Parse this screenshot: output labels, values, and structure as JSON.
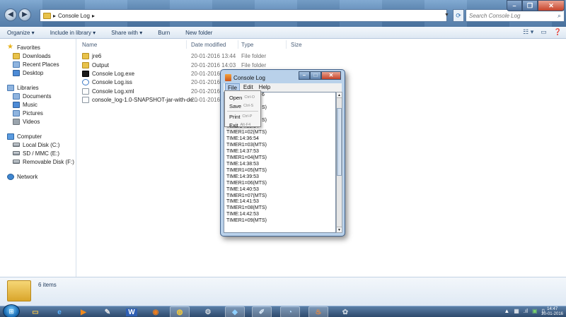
{
  "address": {
    "breadcrumb": [
      "Console Log"
    ]
  },
  "search": {
    "placeholder": "Search Console Log"
  },
  "toolbar": {
    "organize": "Organize ▾",
    "include": "Include in library ▾",
    "share": "Share with ▾",
    "burn": "Burn",
    "new_folder": "New folder"
  },
  "nav": {
    "favorites": "Favorites",
    "favorites_items": [
      "Downloads",
      "Recent Places",
      "Desktop"
    ],
    "libraries": "Libraries",
    "libraries_items": [
      "Documents",
      "Music",
      "Pictures",
      "Videos"
    ],
    "computer": "Computer",
    "computer_items": [
      "Local Disk (C:)",
      "SD / MMC (E:)",
      "Removable Disk (F:)"
    ],
    "network": "Network"
  },
  "columns": {
    "name": "Name",
    "date": "Date modified",
    "type": "Type",
    "size": "Size"
  },
  "files": [
    {
      "name": "jre6",
      "date": "20-01-2016 13:44",
      "type": "File folder",
      "icon": "folder-icon"
    },
    {
      "name": "Output",
      "date": "20-01-2016 14:03",
      "type": "File folder",
      "icon": "folder-icon"
    },
    {
      "name": "Console Log.exe",
      "date": "20-01-2016 1",
      "type": "",
      "icon": "exe-icon"
    },
    {
      "name": "Console Log.iss",
      "date": "20-01-2016 1",
      "type": "",
      "icon": "iss-icon"
    },
    {
      "name": "Console Log.xml",
      "date": "20-01-2016 1",
      "type": "",
      "icon": "xml-icon"
    },
    {
      "name": "console_log-1.0-SNAPSHOT-jar-with-de...",
      "date": "20-01-2016 1",
      "type": "",
      "icon": "jar-icon"
    }
  ],
  "details": {
    "count": "6 items"
  },
  "console": {
    "title": "Console Log",
    "menu": [
      "File",
      "Edit",
      "Help"
    ],
    "file_menu": [
      {
        "label": "Open",
        "accel": "Ctrl-O"
      },
      {
        "label": "Save",
        "accel": "Ctrl-S"
      },
      {
        "label": "Print",
        "accel": "Ctrl-P"
      },
      {
        "label": "Exit",
        "accel": "Alt-F4"
      }
    ],
    "lines": [
      "6",
      "",
      "S)",
      "",
      "S)",
      "TIME:14:35:54",
      "TIMER1=02(MTS)",
      "TIME:14:36:54",
      "TIMER1=03(MTS)",
      "TIME:14:37:53",
      "TIMER1=04(MTS)",
      "TIME:14:38:53",
      "TIMER1=05(MTS)",
      "TIME:14:39:53",
      "TIMER1=06(MTS)",
      "TIME:14:40:53",
      "TIMER1=07(MTS)",
      "TIME:14:41:53",
      "TIMER1=08(MTS)",
      "TIME:14:42:53",
      "TIMER1=09(MTS)"
    ]
  },
  "taskbar": {
    "apps": [
      "explorer-icon",
      "ie-icon",
      "media-player-icon",
      "paint-icon",
      "word-icon",
      "firefox-icon",
      "chrome-icon",
      "tool-icon",
      "box-icon",
      "pen-icon",
      "network-icon",
      "java-icon",
      "settings-icon"
    ],
    "word_label": "W"
  },
  "clock": {
    "time": "14:47",
    "date": "20-01-2016"
  },
  "colors": {
    "accent": "#4c76a4",
    "taskbar": "#2d4a6d"
  }
}
